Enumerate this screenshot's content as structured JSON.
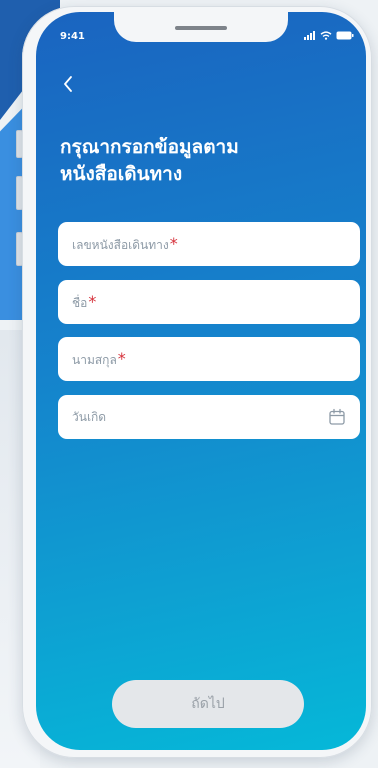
{
  "status_bar": {
    "time": "9:41"
  },
  "header": {
    "back_icon": "chevron-left-icon",
    "title": "กรุณากรอกข้อมูลตามหนังสือเดินทาง"
  },
  "form": {
    "fields": [
      {
        "label": "เลขหนังสือเดินทาง",
        "required_mark": "*"
      },
      {
        "label": "ชื่อ",
        "required_mark": "*"
      },
      {
        "label": "นามสกุล",
        "required_mark": "*"
      },
      {
        "label": "วันเกิด",
        "icon": "calendar-icon"
      }
    ]
  },
  "footer": {
    "next_label": "ถัดไป"
  },
  "colors": {
    "gradient_top": "#1a64c0",
    "gradient_bottom": "#05b8d8",
    "required": "#d6323c",
    "button_disabled_bg": "#e4e7ea",
    "button_disabled_text": "#9aa1a8"
  }
}
